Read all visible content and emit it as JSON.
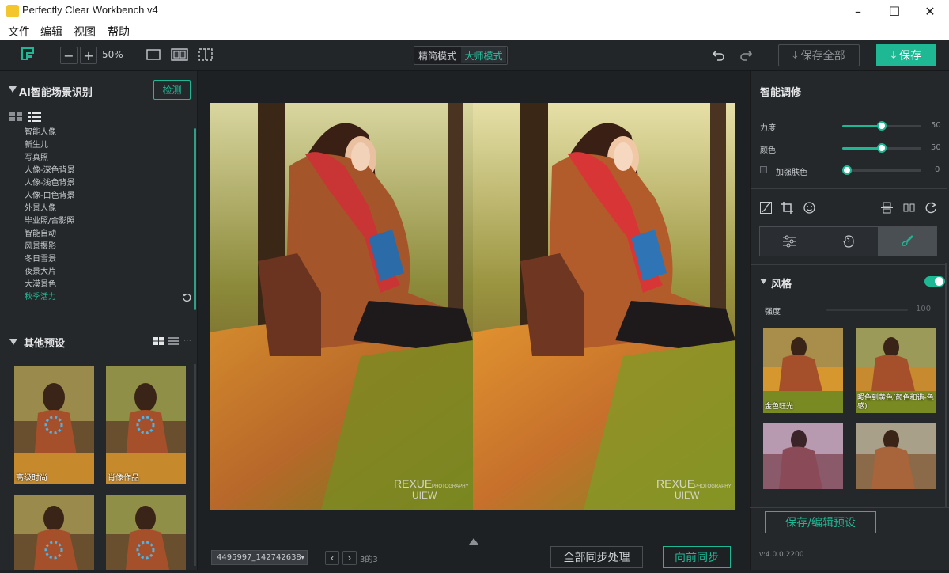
{
  "window": {
    "title": "Perfectly Clear Workbench v4"
  },
  "menu": [
    "文件",
    "编辑",
    "视图",
    "帮助"
  ],
  "toolbar": {
    "zoom": "50%",
    "mode_simple": "精简模式",
    "mode_master": "大师模式",
    "save_all": "保存全部",
    "save": "保存"
  },
  "left": {
    "scene_title": "AI智能场景识别",
    "detect": "检测",
    "scenes": [
      "智能人像",
      "新生儿",
      "写真照",
      "人像-深色背景",
      "人像-浅色背景",
      "人像-白色背景",
      "外景人像",
      "毕业照/合影照",
      "智能自动",
      "风景摄影",
      "冬日雪景",
      "夜景大片",
      "大漠景色",
      "秋季活力"
    ],
    "active_scene": "秋季活力",
    "other_title": "其他预设",
    "presets": [
      "高级时尚",
      "肖像作品"
    ]
  },
  "canvas": {
    "file_name": "4495997_142742638",
    "pager": "3的3",
    "sync_all": "全部同步处理",
    "sync_forward": "向前同步"
  },
  "right": {
    "smart_title": "智能调修",
    "sliders": [
      {
        "label": "力度",
        "value": "50",
        "level": 0.5
      },
      {
        "label": "颜色",
        "value": "50",
        "level": 0.5
      },
      {
        "label": "加强肤色",
        "value": "0",
        "level": 0
      }
    ],
    "style_title": "风格",
    "strength_label": "强度",
    "strength_value": "100",
    "style_labels": [
      "金色旺光",
      "暖色到黄色(颜色和谐-色感)"
    ],
    "save_preset": "保存/编辑预设",
    "version": "v:4.0.0.2200"
  },
  "colors": {
    "accent": "#1fb894",
    "panel": "#25282b",
    "canvas": "#1e2124"
  }
}
